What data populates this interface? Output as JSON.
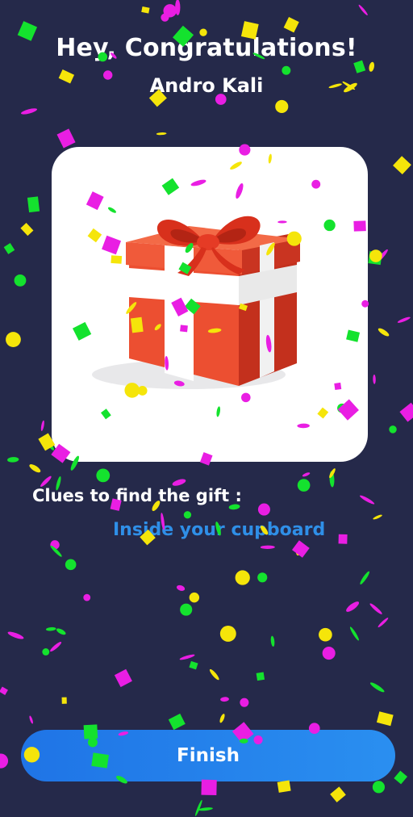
{
  "header": {
    "title": "Hey, Congratulations!",
    "recipient_name": "Andro Kali"
  },
  "gift_image": {
    "icon": "gift-box-icon",
    "box_color": "#e94a2f",
    "ribbon_color": "#ffffff",
    "bow_color": "#d8301c"
  },
  "clues": {
    "label": "Clues to find the gift :",
    "value": "Inside your cupboard"
  },
  "actions": {
    "finish_label": "Finish"
  },
  "colors": {
    "background": "#25294a",
    "accent": "#2a8ff0",
    "confetti": [
      "#e91ee3",
      "#f5e50a",
      "#14e22e"
    ]
  }
}
